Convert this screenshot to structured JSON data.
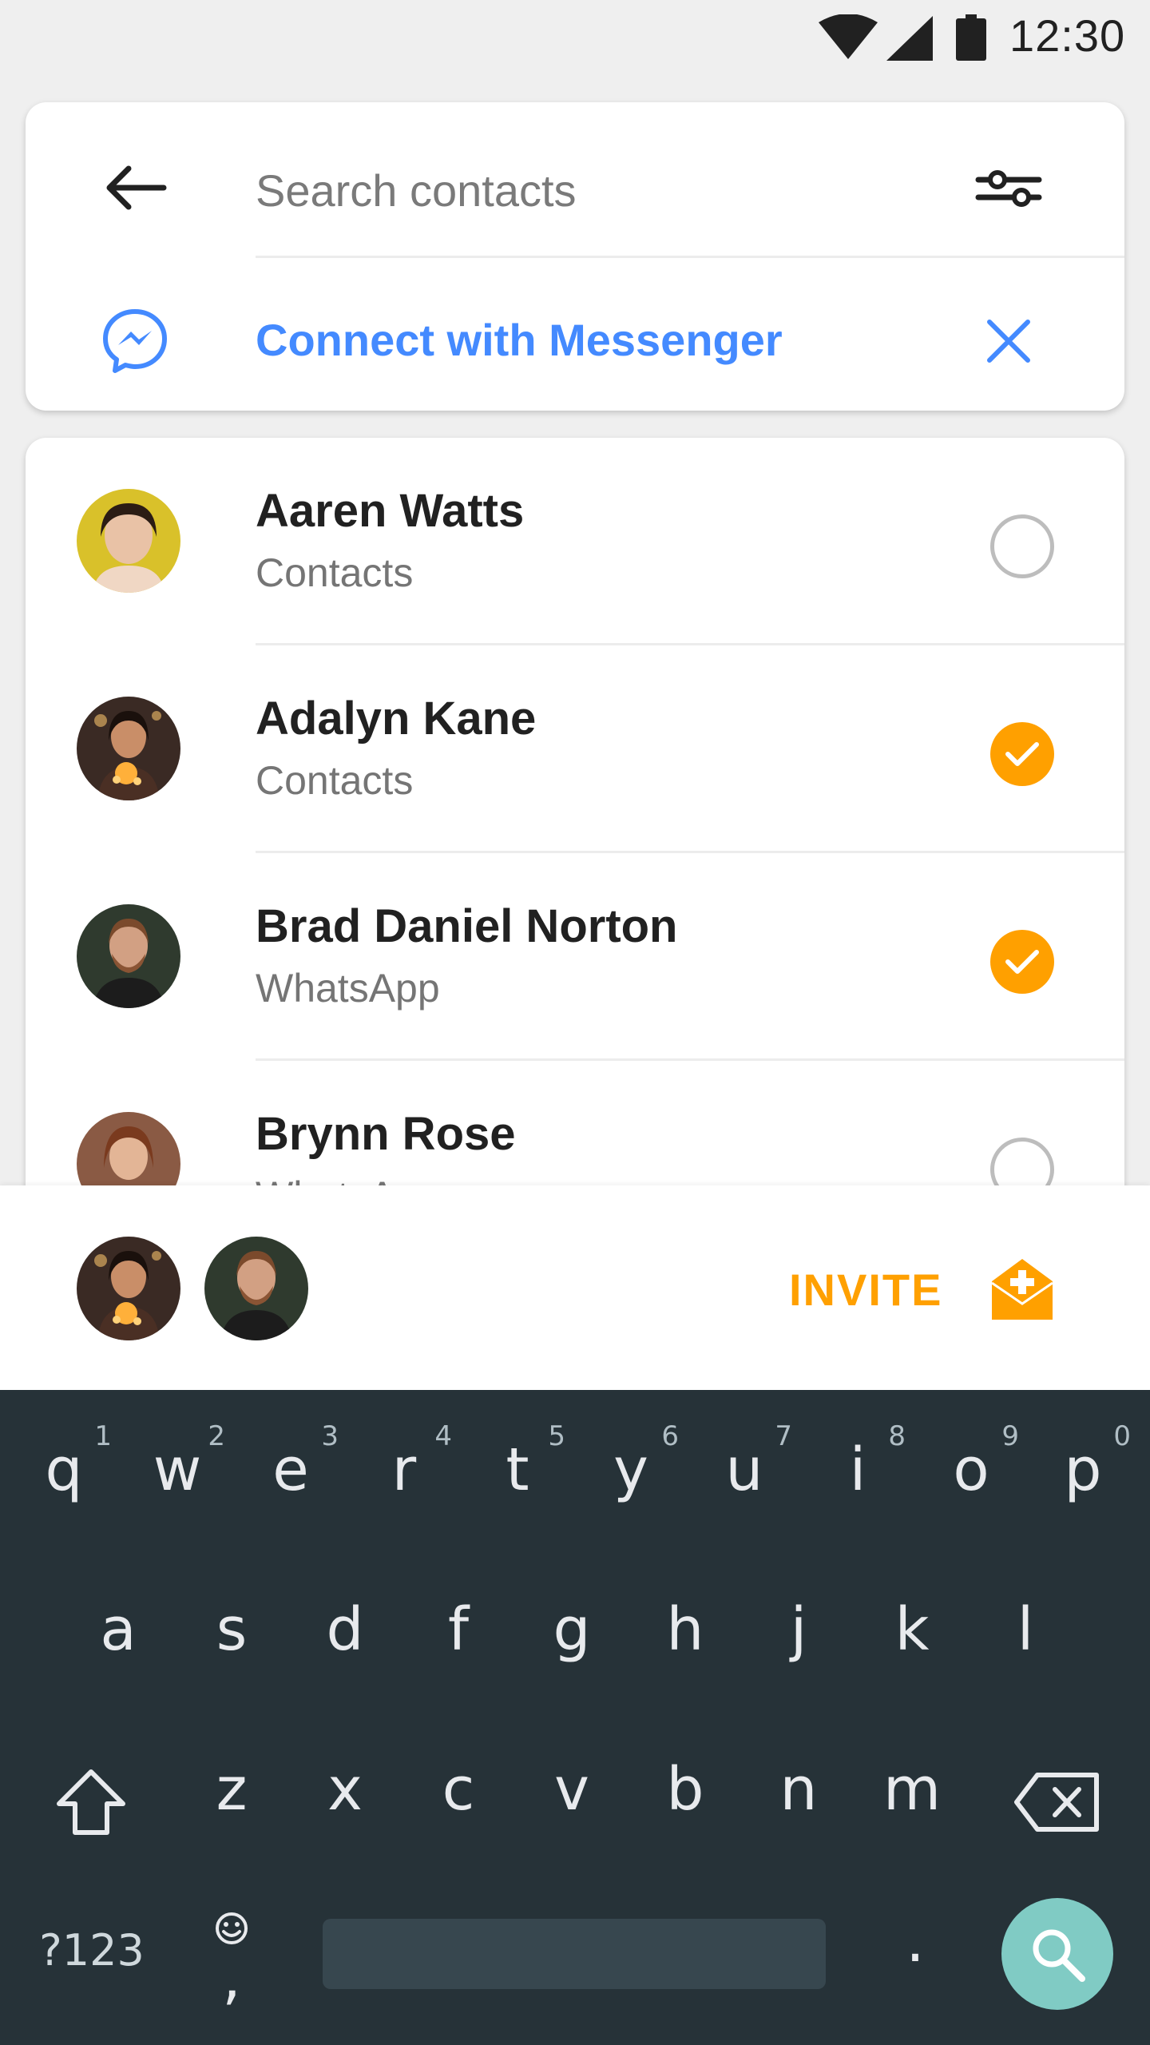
{
  "status_bar": {
    "time": "12:30"
  },
  "search": {
    "placeholder": "Search contacts",
    "value": ""
  },
  "messenger": {
    "label": "Connect with Messenger"
  },
  "contacts": [
    {
      "name": "Aaren Watts",
      "source": "Contacts",
      "selected": false,
      "avatar_color": "#d9c12a"
    },
    {
      "name": "Adalyn Kane",
      "source": "Contacts",
      "selected": true,
      "avatar_color": "#3a2a24"
    },
    {
      "name": "Brad Daniel Norton",
      "source": "WhatsApp",
      "selected": true,
      "avatar_color": "#2f3a2e"
    },
    {
      "name": "Brynn Rose",
      "source": "WhatsApp",
      "selected": false,
      "avatar_color": "#8a5a44"
    }
  ],
  "invite": {
    "label": "INVITE"
  },
  "keyboard": {
    "row1": [
      {
        "key": "q",
        "num": "1"
      },
      {
        "key": "w",
        "num": "2"
      },
      {
        "key": "e",
        "num": "3"
      },
      {
        "key": "r",
        "num": "4"
      },
      {
        "key": "t",
        "num": "5"
      },
      {
        "key": "y",
        "num": "6"
      },
      {
        "key": "u",
        "num": "7"
      },
      {
        "key": "i",
        "num": "8"
      },
      {
        "key": "o",
        "num": "9"
      },
      {
        "key": "p",
        "num": "0"
      }
    ],
    "row2": [
      "a",
      "s",
      "d",
      "f",
      "g",
      "h",
      "j",
      "k",
      "l"
    ],
    "row3": [
      "z",
      "x",
      "c",
      "v",
      "b",
      "n",
      "m"
    ],
    "symbols_label": "?123",
    "comma": ",",
    "period": "."
  },
  "colors": {
    "accent_blue": "#448aff",
    "accent_orange": "#ffa000",
    "keyboard_bg": "#263238",
    "search_key": "#80cbc4"
  }
}
